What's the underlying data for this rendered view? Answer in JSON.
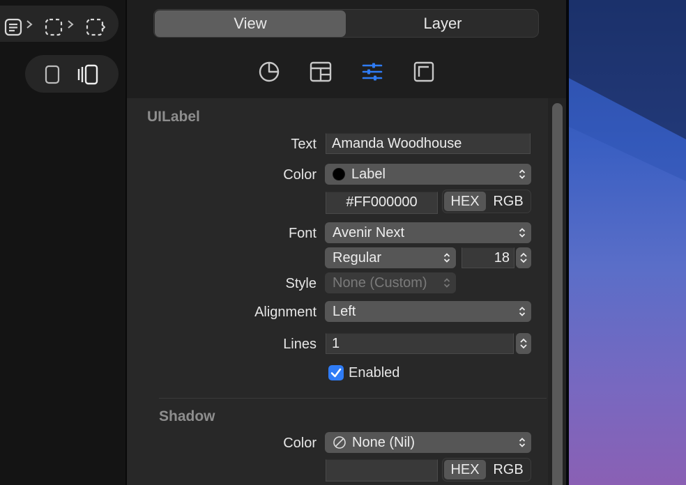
{
  "segmented": {
    "view_label": "View",
    "layer_label": "Layer",
    "selected": "View"
  },
  "inspector_tabs": [
    {
      "icon": "pie-chart-icon",
      "active": false
    },
    {
      "icon": "layout-icon",
      "active": false
    },
    {
      "icon": "sliders-icon",
      "active": true
    },
    {
      "icon": "frame-icon",
      "active": false
    }
  ],
  "uilabel": {
    "title": "UILabel",
    "text_label": "Text",
    "text_value": "Amanda Woodhouse",
    "color_label": "Color",
    "color_value": "Label",
    "hex_value": "#FF000000",
    "hex_label": "HEX",
    "rgb_label": "RGB",
    "font_label": "Font",
    "font_family": "Avenir Next",
    "font_weight": "Regular",
    "font_size": "18",
    "style_label": "Style",
    "style_value": "None (Custom)",
    "alignment_label": "Alignment",
    "alignment_value": "Left",
    "lines_label": "Lines",
    "lines_value": "1",
    "enabled_label": "Enabled",
    "enabled_checked": true
  },
  "shadow": {
    "title": "Shadow",
    "color_label": "Color",
    "color_value": "None (Nil)",
    "hex_value": "",
    "hex_label": "HEX",
    "rgb_label": "RGB"
  },
  "colors": {
    "accent": "#2f7cf6",
    "panel_bg": "#282828",
    "label_swatch": "#000000"
  }
}
